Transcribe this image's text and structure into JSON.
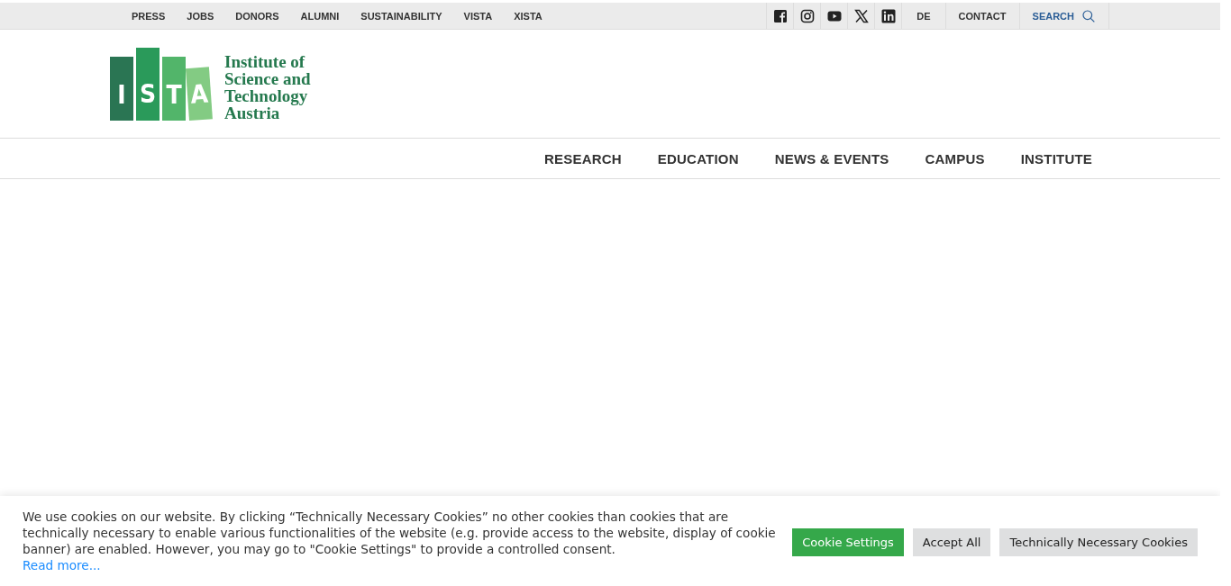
{
  "top_bar": {
    "links": [
      "PRESS",
      "JOBS",
      "DONORS",
      "ALUMNI",
      "SUSTAINABILITY",
      "VISTA",
      "XISTA"
    ],
    "social": [
      {
        "kind": "facebook"
      },
      {
        "kind": "instagram"
      },
      {
        "kind": "youtube"
      },
      {
        "kind": "x"
      },
      {
        "kind": "linkedin"
      }
    ],
    "language": "DE",
    "contact": "CONTACT",
    "search": "SEARCH"
  },
  "logo": {
    "letters": [
      "I",
      "S",
      "T",
      "A"
    ],
    "wordmark": [
      "Institute of",
      "Science and",
      "Technology",
      "Austria"
    ]
  },
  "main_nav": [
    "RESEARCH",
    "EDUCATION",
    "NEWS & EVENTS",
    "CAMPUS",
    "INSTITUTE"
  ],
  "cookie_banner": {
    "text": "We use cookies on our website. By clicking “Technically Necessary Cookies” no other cookies than cookies that are technically necessary to enable various functionalities of the website (e.g. provide access to the website, display of cookie banner) are enabled. However, you may go to \"Cookie Settings\" to provide a controlled consent.",
    "read_more": "Read more...",
    "buttons": [
      {
        "label": "Cookie Settings",
        "kind": "primary"
      },
      {
        "label": "Accept All",
        "kind": "secondary"
      },
      {
        "label": "Technically Necessary Cookies",
        "kind": "secondary"
      }
    ]
  }
}
